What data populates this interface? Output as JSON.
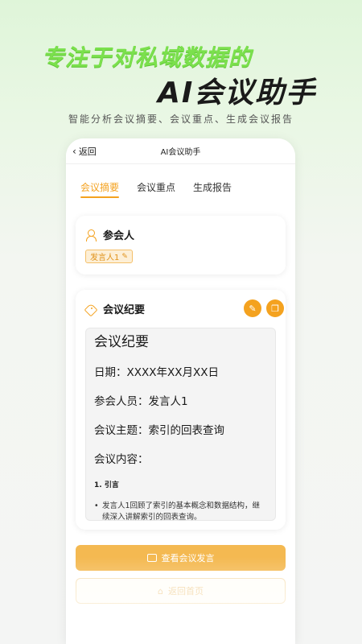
{
  "hero": {
    "line1": "专注于对私域数据的",
    "line2": "AI会议助手",
    "subtitle": "智能分析会议摘要、会议重点、生成会议报告"
  },
  "navbar": {
    "back_label": "返回",
    "title": "AI会议助手"
  },
  "tabs": [
    {
      "label": "会议摘要",
      "active": true
    },
    {
      "label": "会议重点",
      "active": false
    },
    {
      "label": "生成报告",
      "active": false
    }
  ],
  "participants": {
    "title": "参会人",
    "speaker_tag": "发言人1"
  },
  "minutes": {
    "title": "会议纪要",
    "heading": "会议纪要",
    "date_line": "日期：XXXX年XX月XX日",
    "attendees_line": "参会人员：发言人1",
    "topic_line": "会议主题：索引的回表查询",
    "content_line": "会议内容：",
    "section1": "1. 引言",
    "bullet1": "发言人1回顾了索引的基本概念和数据结构，继续深入讲解索引的回表查询。"
  },
  "buttons": {
    "view_speech": "查看会议发言",
    "back_home": "返回首页"
  },
  "colors": {
    "accent": "#f4a21f",
    "hero_green": "#7be04d"
  }
}
